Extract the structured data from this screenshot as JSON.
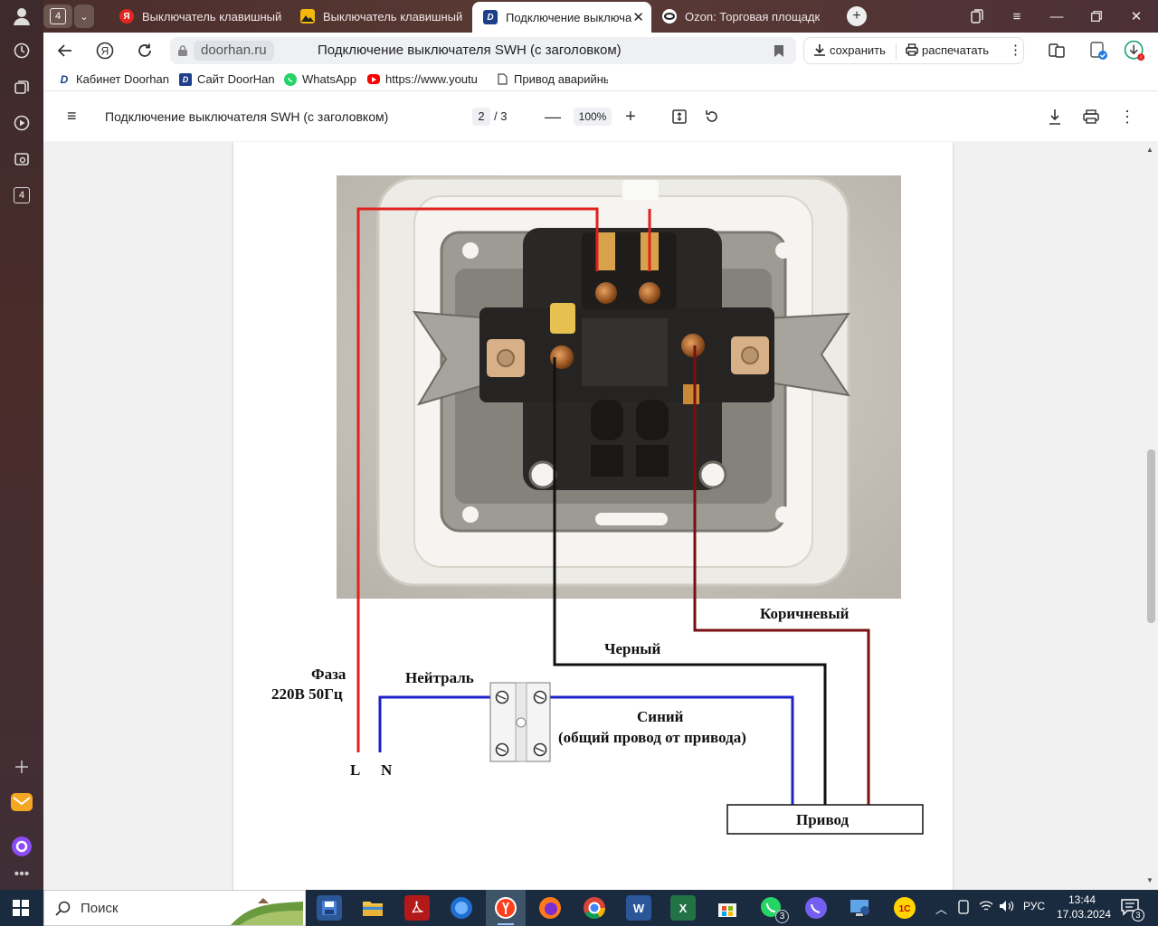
{
  "tabs": {
    "count_badge": "4",
    "items": [
      {
        "label": "Выключатель клавишный",
        "favicon": "yandex"
      },
      {
        "label": "Выключатель клавишный",
        "favicon": "image"
      },
      {
        "label": "Подключение выключа",
        "favicon": "doorhan",
        "active": true
      },
      {
        "label": "Ozon: Торговая площадк",
        "favicon": "ozon"
      }
    ]
  },
  "sidebar": {
    "badge": "4"
  },
  "navbar": {
    "domain": "doorhan.ru",
    "page_title": "Подключение выключателя SWH (с заголовком)",
    "save_label": "сохранить",
    "print_label": "распечатать"
  },
  "bookmarks": [
    {
      "label": "Кабинет Doorhan",
      "icon": "doorhan-icon"
    },
    {
      "label": "Сайт DoorHan",
      "icon": "doorhan-icon"
    },
    {
      "label": "WhatsApp",
      "icon": "whatsapp-icon"
    },
    {
      "label": "https://www.youtu",
      "icon": "youtube-icon"
    },
    {
      "label": "Привод аварийны",
      "icon": "document-icon"
    }
  ],
  "pdf": {
    "title": "Подключение выключателя SWH (с заголовком)",
    "current_page": "2",
    "page_sep": "/ 3",
    "zoom": "100%"
  },
  "diagram": {
    "label_brown": "Коричневый",
    "label_black": "Черный",
    "label_phase": "Фаза",
    "label_voltage": "220В 50Гц",
    "label_neutral": "Нейтраль",
    "label_blue": "Синий",
    "label_common": "(общий провод от привода)",
    "label_L": "L",
    "label_N": "N",
    "label_drive": "Привод",
    "colors": {
      "red": "#e0211c",
      "black": "#111111",
      "blue": "#1a22c8",
      "brown": "#7a0f0f"
    }
  },
  "taskbar": {
    "search_label": "Поиск",
    "language": "РУС",
    "time": "13:44",
    "date": "17.03.2024",
    "notification_count": "3",
    "whatsapp_count": "3"
  }
}
